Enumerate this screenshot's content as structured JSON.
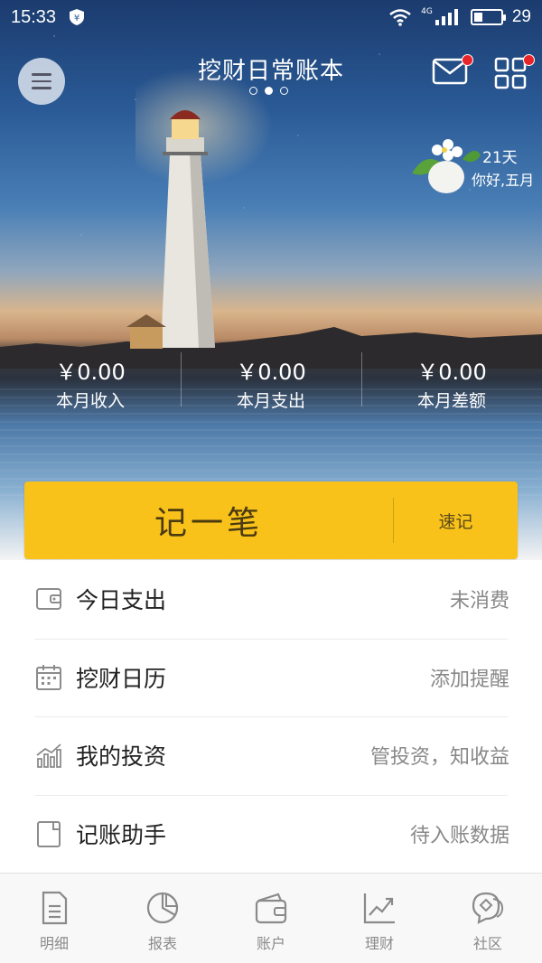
{
  "status_bar": {
    "time": "15:33",
    "network": "4G",
    "battery_level": "29",
    "battery_fraction": 0.29
  },
  "header": {
    "title": "挖财日常账本",
    "page_count": 3,
    "active_page": 2
  },
  "checkin": {
    "days": "21天",
    "greeting": "你好,五月"
  },
  "stats": [
    {
      "amount": "￥0.00",
      "label": "本月收入"
    },
    {
      "amount": "￥0.00",
      "label": "本月支出"
    },
    {
      "amount": "￥0.00",
      "label": "本月差额"
    }
  ],
  "record": {
    "main_label": "记一笔",
    "quick_label": "速记"
  },
  "list": [
    {
      "icon": "wallet-icon",
      "title": "今日支出",
      "hint": "未消费"
    },
    {
      "icon": "calendar-icon",
      "title": "挖财日历",
      "hint": "添加提醒"
    },
    {
      "icon": "bar-chart-icon",
      "title": "我的投资",
      "hint": "管投资，知收益"
    },
    {
      "icon": "notebook-icon",
      "title": "记账助手",
      "hint": "待入账数据"
    }
  ],
  "tabs": [
    {
      "icon": "document-icon",
      "label": "明细"
    },
    {
      "icon": "pie-chart-icon",
      "label": "报表"
    },
    {
      "icon": "wallet-icon",
      "label": "账户"
    },
    {
      "icon": "trend-icon",
      "label": "理财"
    },
    {
      "icon": "community-icon",
      "label": "社区"
    }
  ],
  "colors": {
    "accent": "#f9c21a",
    "badge": "#e8242b"
  }
}
